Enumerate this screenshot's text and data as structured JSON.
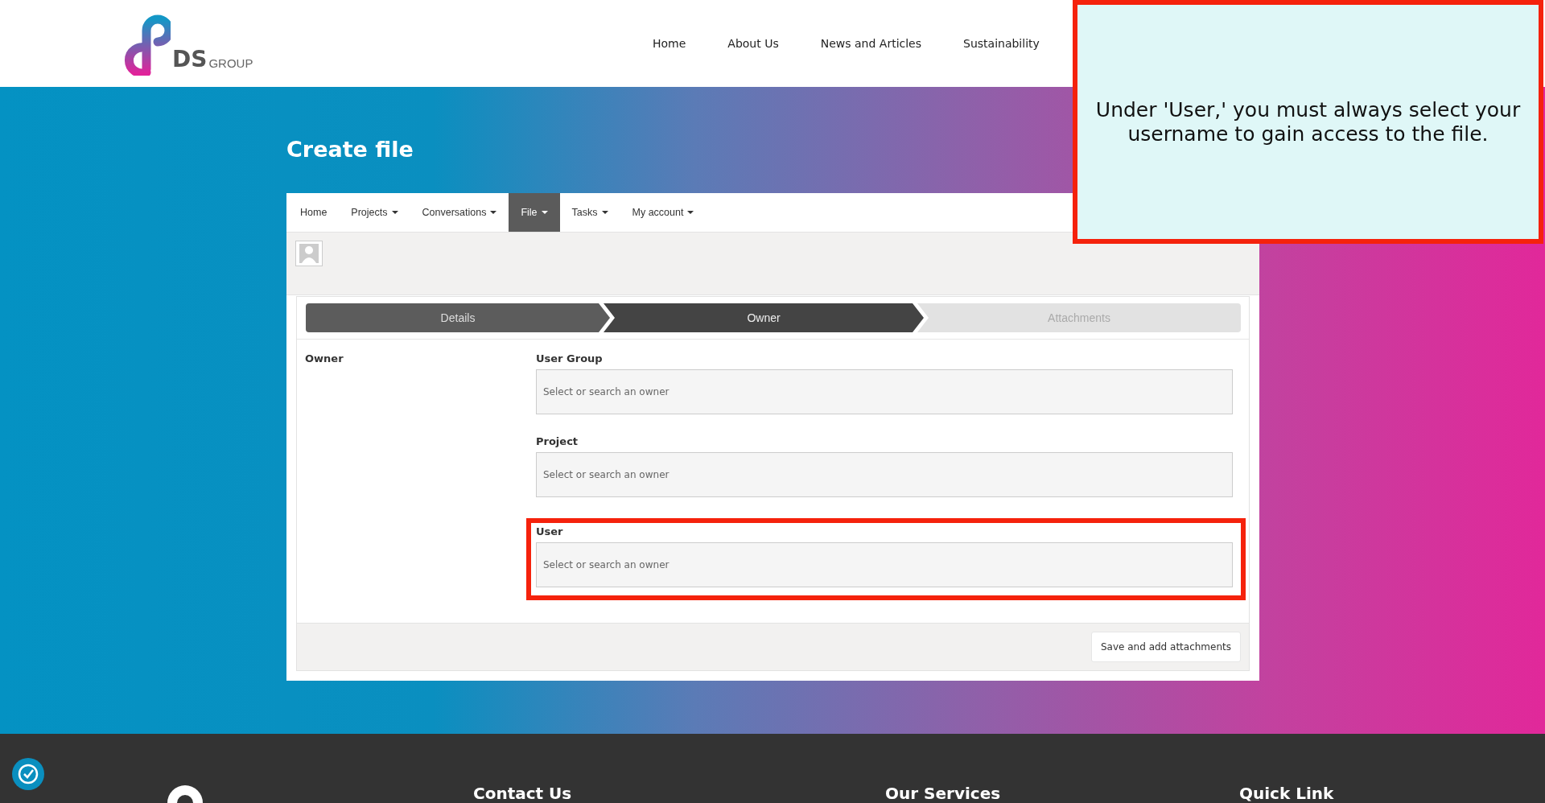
{
  "header": {
    "logo": {
      "mark": "DS",
      "word": "GROUP"
    },
    "nav": [
      "Home",
      "About Us",
      "News and Articles",
      "Sustainability"
    ]
  },
  "page_title": "Create file",
  "menu": [
    {
      "label": "Home",
      "dropdown": false,
      "selected": false
    },
    {
      "label": "Projects",
      "dropdown": true,
      "selected": false
    },
    {
      "label": "Conversations",
      "dropdown": true,
      "selected": false
    },
    {
      "label": "File",
      "dropdown": true,
      "selected": true
    },
    {
      "label": "Tasks",
      "dropdown": true,
      "selected": false
    },
    {
      "label": "My account",
      "dropdown": true,
      "selected": false
    }
  ],
  "steps": [
    {
      "label": "Details",
      "kind": "done"
    },
    {
      "label": "Owner",
      "kind": "current"
    },
    {
      "label": "Attachments",
      "kind": "pending"
    }
  ],
  "section_label": "Owner",
  "fields": [
    {
      "label": "User Group",
      "placeholder": "Select or search an owner",
      "highlighted": false
    },
    {
      "label": "Project",
      "placeholder": "Select or search an owner",
      "highlighted": false
    },
    {
      "label": "User",
      "placeholder": "Select or search an owner",
      "highlighted": true
    }
  ],
  "save_button": "Save and add attachments",
  "callout": "Under 'User,' you must always select your username to gain access to the file.",
  "footer": {
    "headings": [
      "Contact Us",
      "Our Services",
      "Quick Link"
    ]
  }
}
